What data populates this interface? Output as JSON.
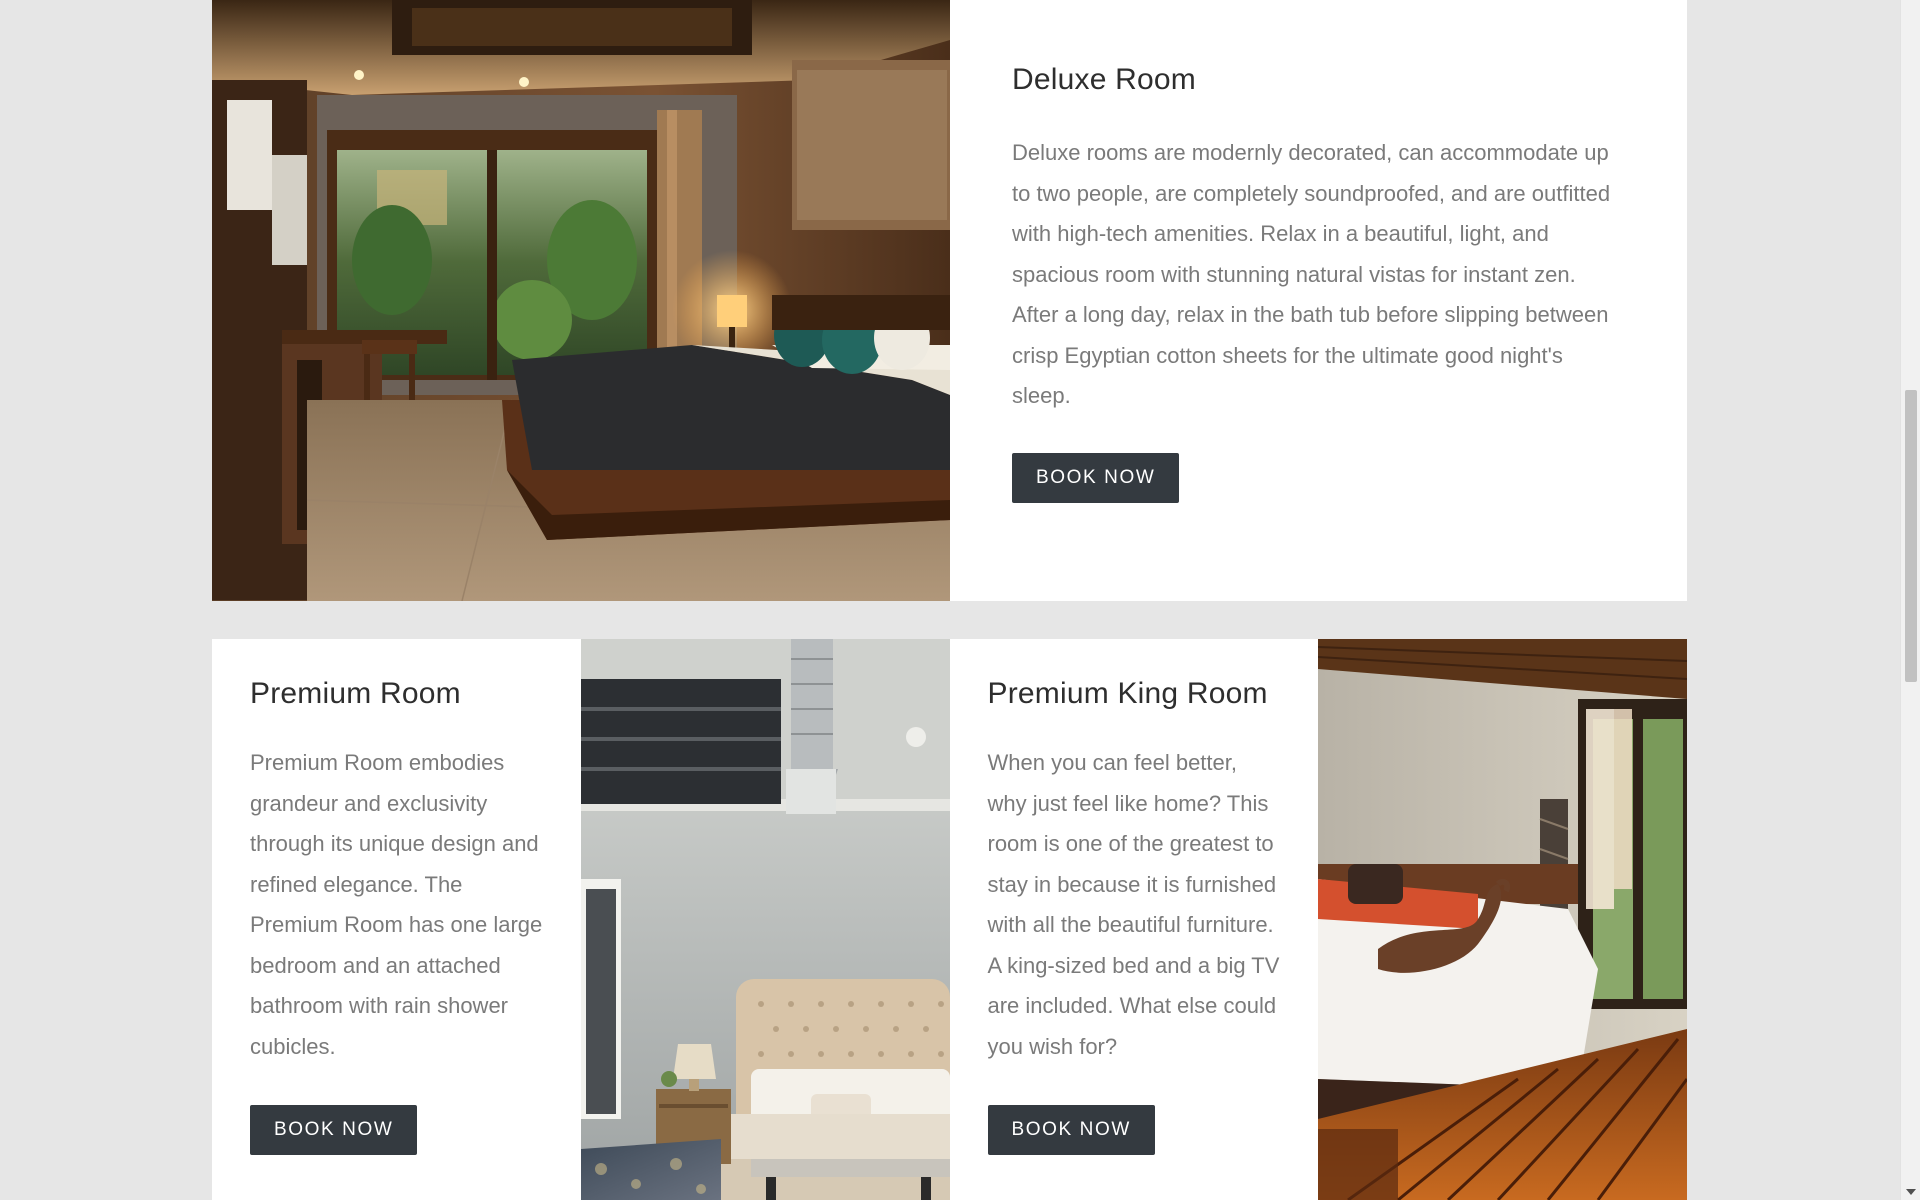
{
  "rooms": [
    {
      "title": "Deluxe Room",
      "description": "Deluxe rooms are modernly decorated, can accommodate up to two people, are completely soundproofed, and are outfitted with high-tech amenities. Relax in a beautiful, light, and spacious room with stunning natural vistas for instant zen. After a long day, relax in the bath tub before slipping between crisp Egyptian cotton sheets for the ultimate good night's sleep.",
      "button_label": "BOOK NOW",
      "image_alt": "Deluxe room with wooden bed, teal pillows and garden view"
    },
    {
      "title": "Premium Room",
      "description": "Premium Room embodies grandeur and exclusivity through its unique design and refined elegance. The Premium Room has one large bedroom and an attached bathroom with rain shower cubicles.",
      "button_label": "BOOK NOW",
      "image_alt": "Premium room with tufted headboard and loft"
    },
    {
      "title": "Premium King Room",
      "description": "When you can feel better, why just feel like home? This room is one of the greatest to stay in because it is furnished with all the beautiful furniture. A king-sized bed and a big TV are included. What else could you wish for?",
      "button_label": "BOOK NOW",
      "image_alt": "Premium king room with towel swan on bed and wooden floor"
    }
  ],
  "colors": {
    "page_background": "#e6e6e6",
    "panel_background": "#ffffff",
    "title_text": "#2e2e2e",
    "body_text": "#7a7a7a",
    "button_background": "#343a40",
    "button_text": "#ffffff"
  }
}
